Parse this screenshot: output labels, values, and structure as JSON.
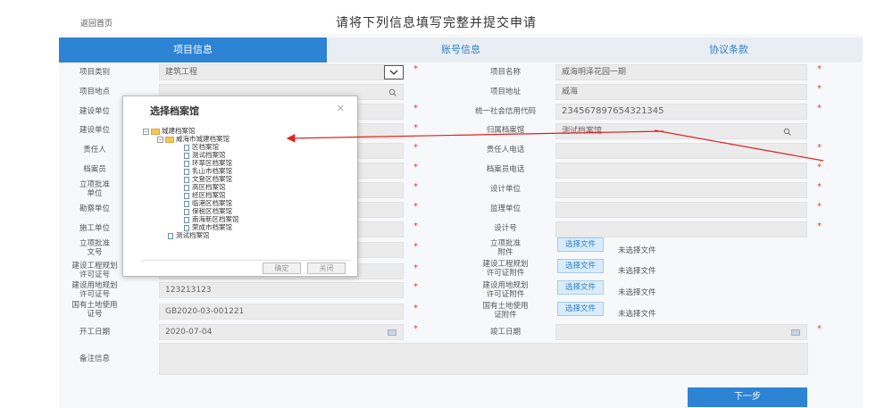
{
  "header": {
    "back_label": "返回首页",
    "headline": "请将下列信息填写完整并提交申请"
  },
  "tabs": [
    {
      "label": "项目信息",
      "active": true
    },
    {
      "label": "账号信息",
      "active": false
    },
    {
      "label": "协议条款",
      "active": false
    }
  ],
  "left_form": {
    "project_type": {
      "label": "项目类别",
      "value": "建筑工程"
    },
    "project_location": {
      "label": "项目地点",
      "value": ""
    },
    "build_unit1": {
      "label": "建设单位",
      "value": ""
    },
    "build_unit2": {
      "label": "建设单位",
      "value": ""
    },
    "responsible": {
      "label": "责任人",
      "value": ""
    },
    "archivist": {
      "label": "档案员",
      "value": ""
    },
    "approval_doc": {
      "label": "立项批准\n单位",
      "value": ""
    },
    "survey": {
      "label": "勘察单位",
      "value": ""
    },
    "construction": {
      "label": "施工单位",
      "value": ""
    },
    "approval_no": {
      "label": "立项批准\n文号",
      "value": ""
    },
    "planning_permit": {
      "label": "建设工程规划\n许可证号",
      "value": ""
    },
    "land_permit": {
      "label": "建设用地规划\n许可证号",
      "value": "123213123"
    },
    "land_use": {
      "label": "国有土地使用\n证号",
      "value": "GB2020-03-001221"
    },
    "start_date": {
      "label": "开工日期",
      "value": "2020-07-04"
    },
    "remark": {
      "label": "备注信息"
    }
  },
  "right_form": {
    "project_name": {
      "label": "项目名称",
      "value": "威海明泽花园一期"
    },
    "project_address": {
      "label": "项目地址",
      "value": "威海"
    },
    "credit_code": {
      "label": "统一社会信用代码",
      "value": "234567897654321345"
    },
    "archive_hall": {
      "label": "归属档案馆",
      "value": "测试档案馆"
    },
    "responsible_phone": {
      "label": "责任人电话",
      "value": ""
    },
    "archivist_phone": {
      "label": "档案员电话",
      "value": ""
    },
    "design_unit": {
      "label": "设计单位",
      "value": ""
    },
    "supervise_unit": {
      "label": "监理单位",
      "value": ""
    },
    "design_no": {
      "label": "设计号",
      "value": ""
    },
    "approval_attach": {
      "label": "立项批准\n附件"
    },
    "planning_attach": {
      "label": "建设工程规划\n许可证附件"
    },
    "land_planning_attach": {
      "label": "建设用地规划\n许可证附件"
    },
    "land_use_attach": {
      "label": "国有土地使用\n证附件"
    },
    "finish_date": {
      "label": "竣工日期",
      "value": ""
    }
  },
  "file_upload": {
    "button_label": "选择文件",
    "none_text": "未选择文件"
  },
  "next_button": "下一步",
  "required_mark": "*",
  "modal": {
    "title": "选择档案馆",
    "close": "✕",
    "tree": {
      "root": "城建档案馆",
      "child": "威海市城建档案馆",
      "leaves": [
        "区档案馆",
        "测试档案馆",
        "环翠区档案馆",
        "乳山市档案馆",
        "文登区档案馆",
        "高区档案馆",
        "经区档案馆",
        "临港区档案馆",
        "保税区档案馆",
        "南海新区档案馆",
        "荣成市档案馆"
      ],
      "sibling": "测试档案馆"
    },
    "ok_label": "确定",
    "close_label": "关闭"
  },
  "colors": {
    "primary": "#2d83d4",
    "required": "#e23b3b",
    "arrow": "#e02020"
  }
}
